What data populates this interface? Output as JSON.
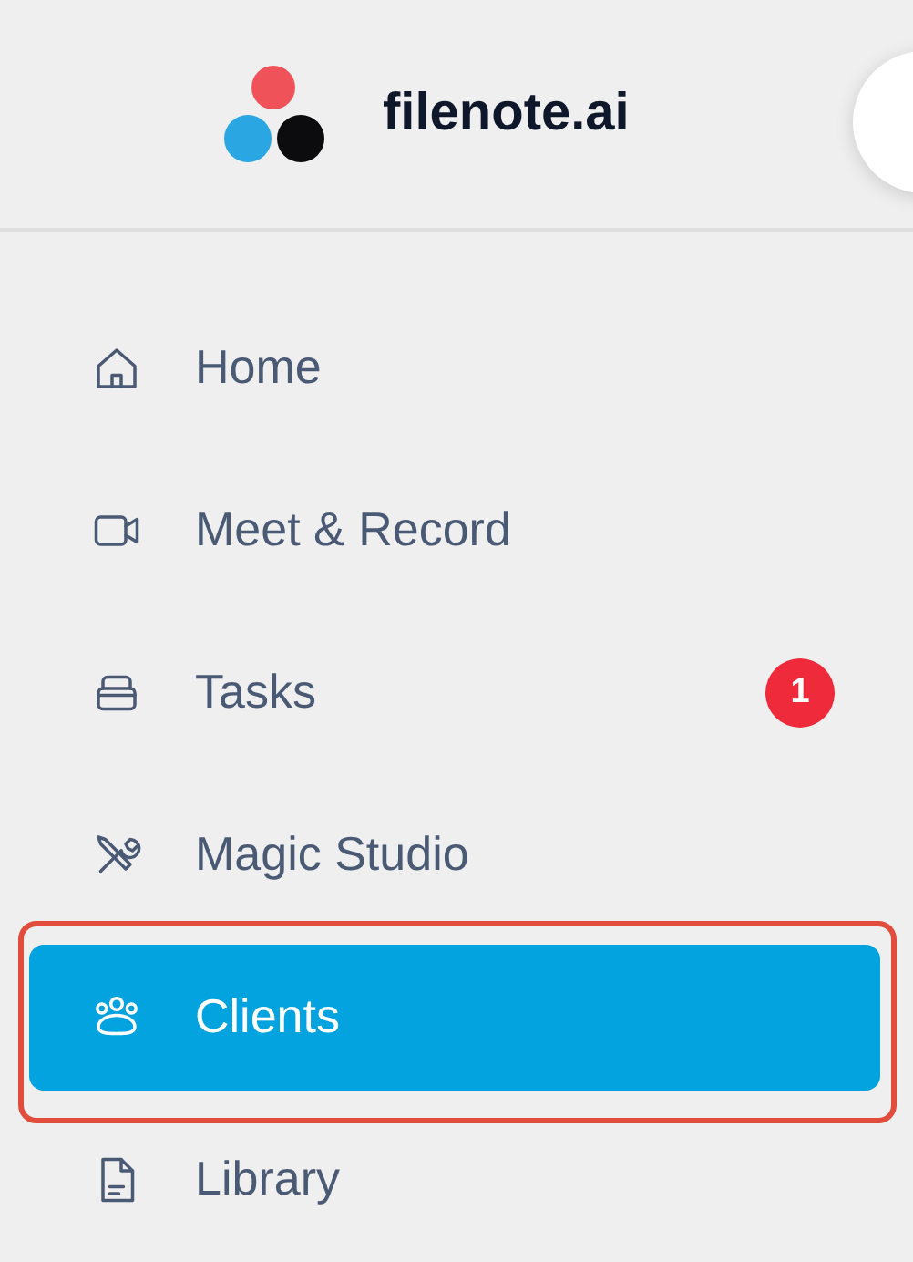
{
  "brand": {
    "name": "filenote.ai"
  },
  "nav": [
    {
      "kind": "home",
      "label": "Home",
      "selected": false,
      "highlighted": false
    },
    {
      "kind": "video",
      "label": "Meet & Record",
      "selected": false,
      "highlighted": false
    },
    {
      "kind": "tray",
      "label": "Tasks",
      "selected": false,
      "highlighted": false,
      "badge": "1"
    },
    {
      "kind": "tools",
      "label": "Magic Studio",
      "selected": false,
      "highlighted": false
    },
    {
      "kind": "people",
      "label": "Clients",
      "selected": true,
      "highlighted": true
    },
    {
      "kind": "document",
      "label": "Library",
      "selected": false,
      "highlighted": false
    }
  ]
}
